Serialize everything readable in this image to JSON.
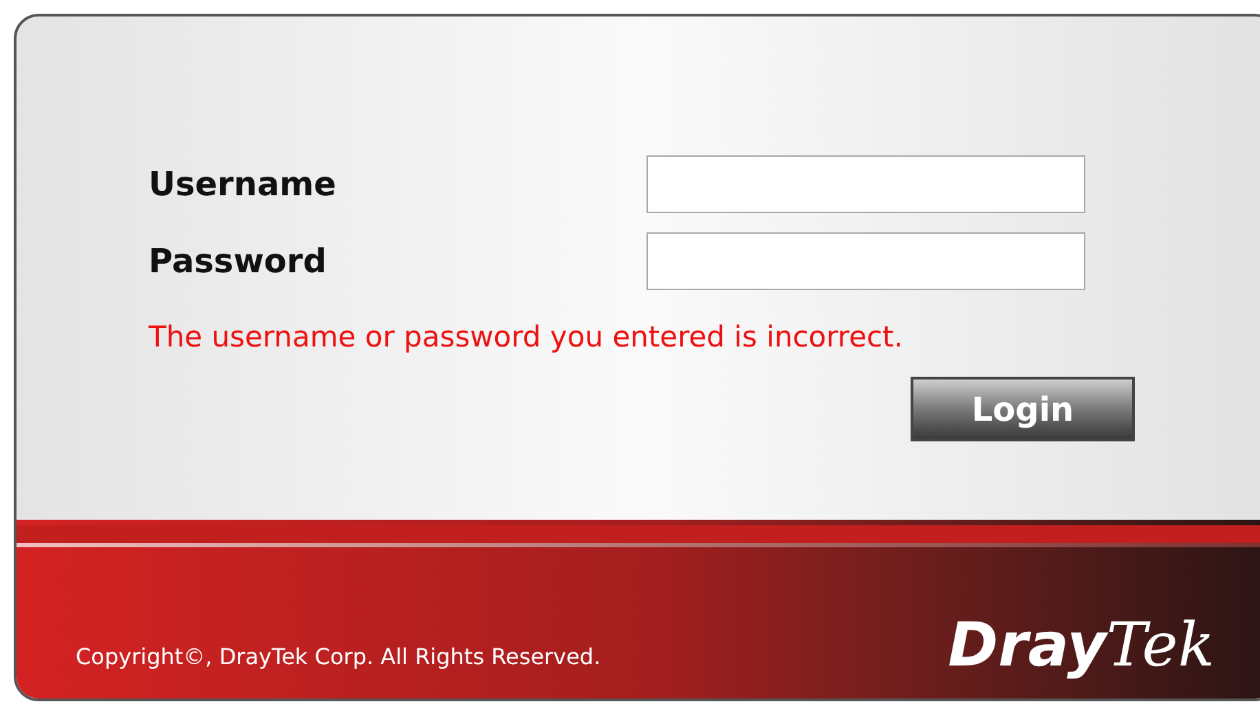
{
  "fields": [
    {
      "label": "Username"
    },
    {
      "label": "Password"
    }
  ],
  "error_message": "The username or password you entered is incorrect.",
  "login_button": "Login",
  "footer": {
    "copyright": "Copyright©, DrayTek Corp. All Rights Reserved.",
    "logo": {
      "bold_part": "Dray",
      "italic_part": "Tek"
    }
  }
}
